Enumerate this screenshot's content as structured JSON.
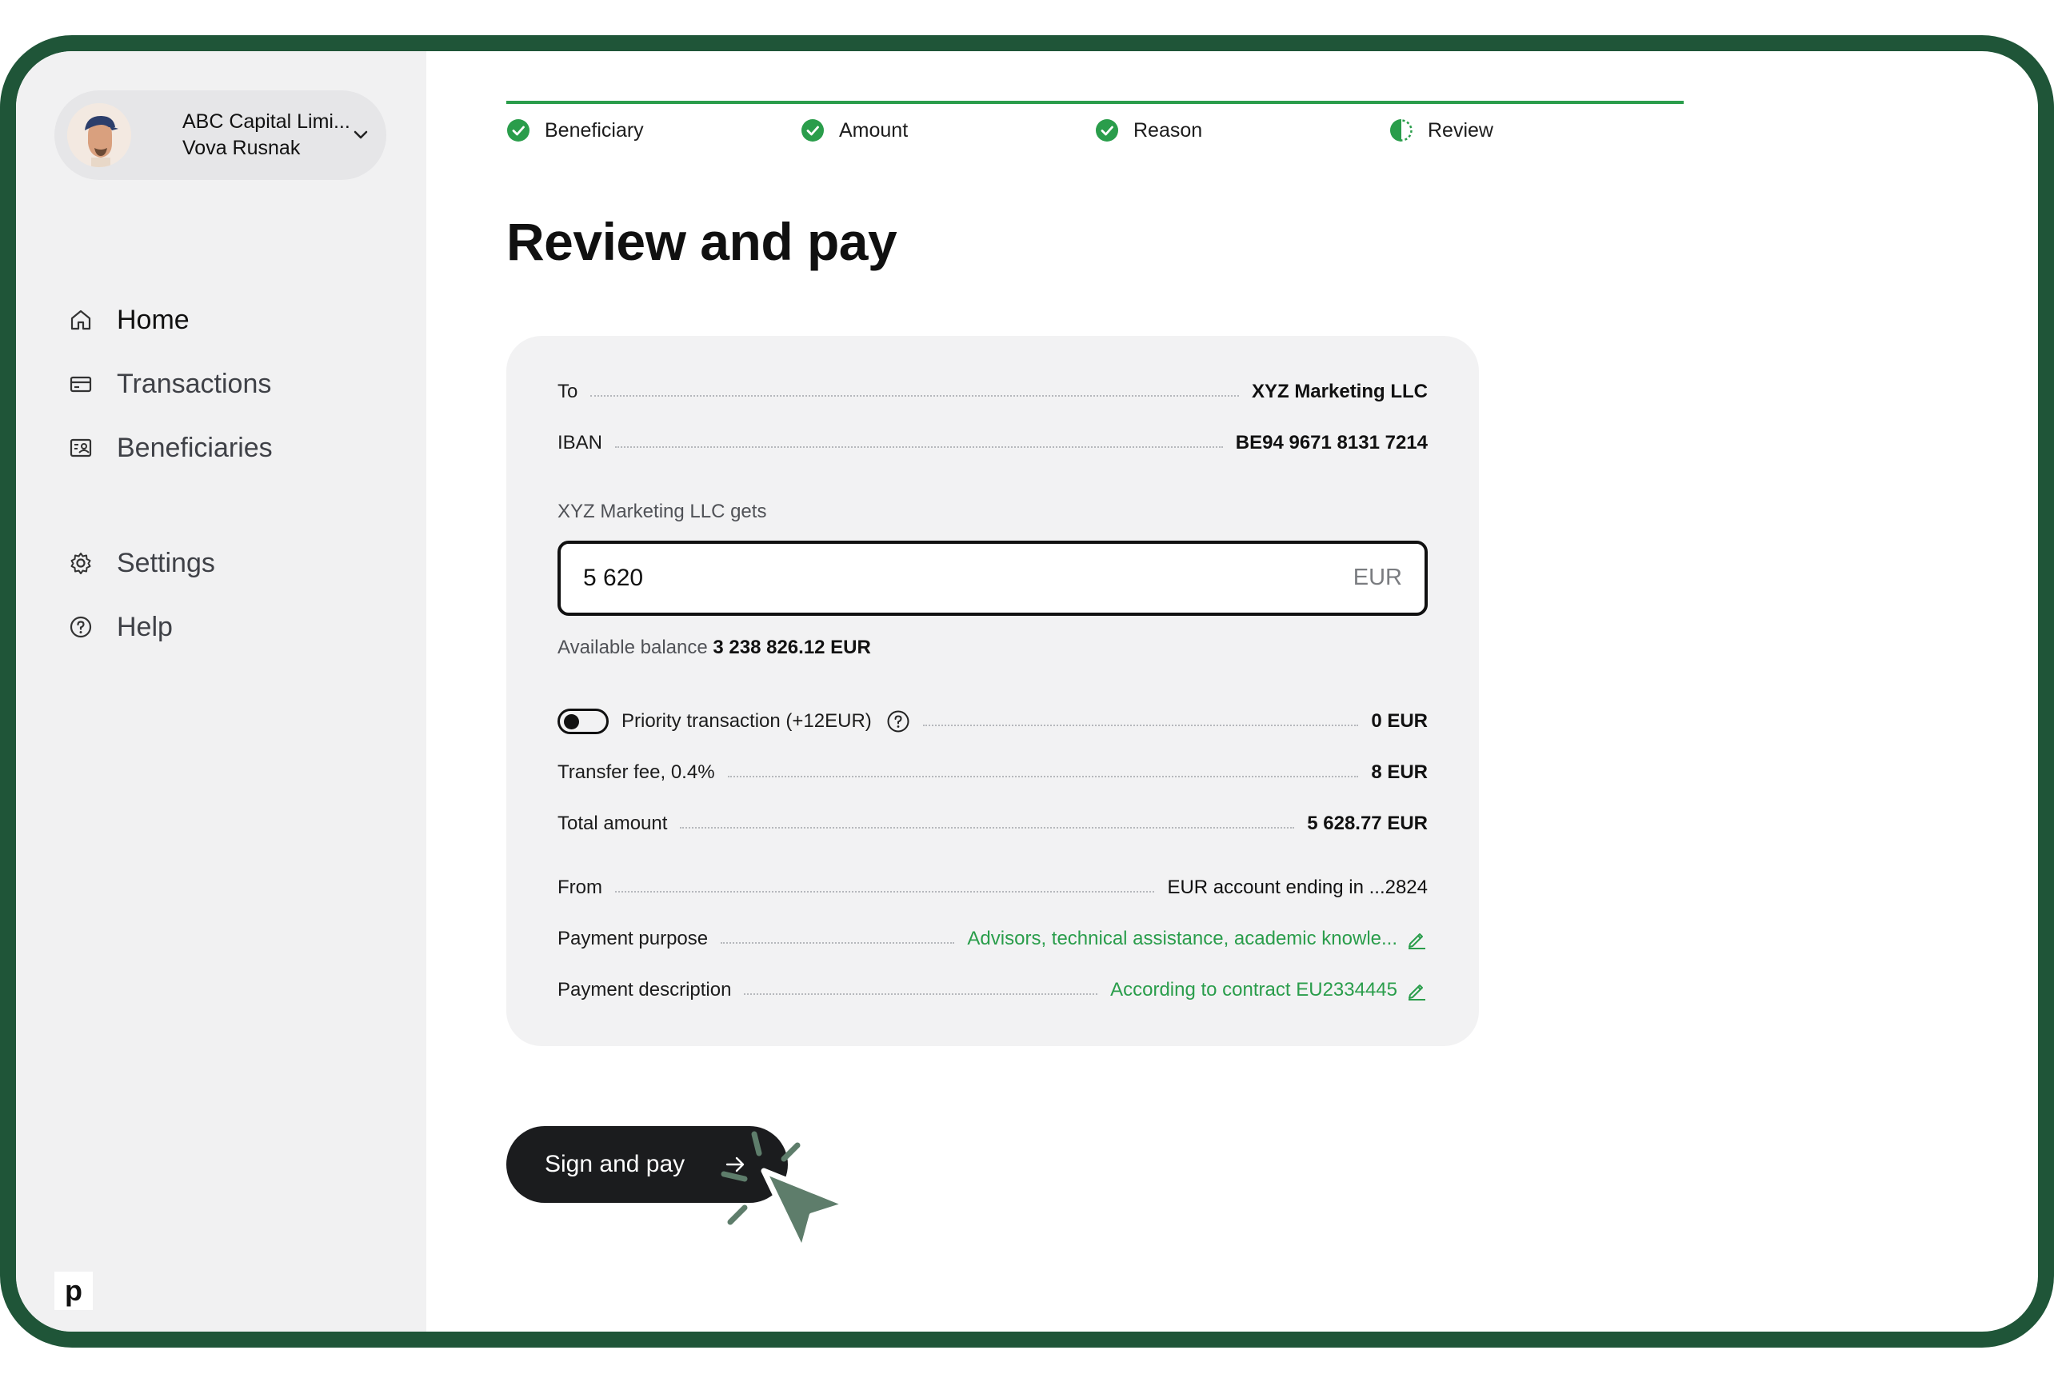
{
  "account": {
    "company": "ABC Capital Limi...",
    "user": "Vova Rusnak"
  },
  "nav": {
    "home": "Home",
    "transactions": "Transactions",
    "beneficiaries": "Beneficiaries",
    "settings": "Settings",
    "help": "Help"
  },
  "logo": "p",
  "steps": [
    {
      "label": "Beneficiary",
      "state": "done"
    },
    {
      "label": "Amount",
      "state": "done"
    },
    {
      "label": "Reason",
      "state": "done"
    },
    {
      "label": "Review",
      "state": "current"
    }
  ],
  "page_title": "Review and pay",
  "summary": {
    "to_label": "To",
    "to_value": "XYZ Marketing LLC",
    "iban_label": "IBAN",
    "iban_value": "BE94 9671 8131 7214",
    "gets_label": "XYZ Marketing LLC gets",
    "amount_value": "5 620",
    "amount_currency": "EUR",
    "balance_label": "Available balance",
    "balance_value": "3 238 826.12 EUR",
    "priority_label": "Priority transaction (+12EUR)",
    "priority_enabled": false,
    "priority_value": "0 EUR",
    "fee_label": "Transfer fee, 0.4%",
    "fee_value": "8 EUR",
    "total_label": "Total amount",
    "total_value": "5 628.77 EUR",
    "from_label": "From",
    "from_value": "EUR account ending in ...2824",
    "purpose_label": "Payment purpose",
    "purpose_value": "Advisors, technical assistance, academic knowle...",
    "description_label": "Payment description",
    "description_value": "According to contract EU2334445"
  },
  "sign_button": "Sign and pay",
  "colors": {
    "frame": "#1f5538",
    "accent": "#2a9d4b",
    "sidebar_bg": "#f1f1f2",
    "button_bg": "#1b1c1e",
    "cursor": "#5e7d6b"
  }
}
